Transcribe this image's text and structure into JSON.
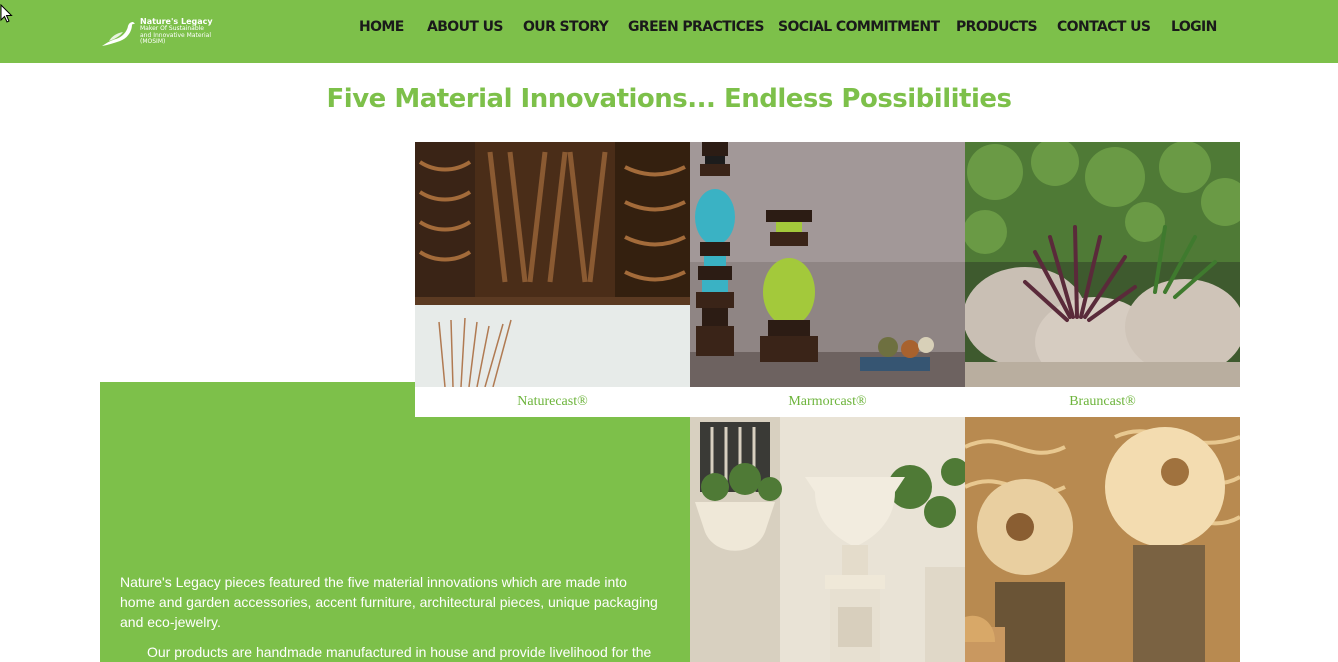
{
  "brand": {
    "name": "Nature's Legacy",
    "tagline_lines": [
      "Maker Of Sustainable",
      "and Innovative Material",
      "(MOSIM)"
    ],
    "logo_icon": "bird-icon",
    "color": "#7dc04a"
  },
  "nav": {
    "items": [
      {
        "label": "HOME"
      },
      {
        "label": "ABOUT US"
      },
      {
        "label": "OUR STORY"
      },
      {
        "label": "GREEN PRACTICES"
      },
      {
        "label": "SOCIAL COMMITMENT"
      },
      {
        "label": "PRODUCTS"
      },
      {
        "label": "CONTACT US"
      },
      {
        "label": "LOGIN"
      }
    ]
  },
  "main": {
    "headline": "Five Material Innovations... Endless Possibilities",
    "intro_paragraph": "Nature's Legacy pieces featured the five material innovations which are made into home and garden accessories, accent furniture, architectural pieces, unique packaging and eco-jewelry.",
    "second_paragraph": "Our products are handmade manufactured in house and provide livelihood for the",
    "materials": [
      {
        "label": "Naturecast®",
        "image": "carved-wall-panel-photo"
      },
      {
        "label": "Marmorcast®",
        "image": "candle-holders-photo"
      },
      {
        "label": "Brauncast®",
        "image": "garden-planter-photo"
      },
      {
        "label": "",
        "image": "classical-urn-photo"
      },
      {
        "label": "",
        "image": "sculpted-fountain-photo"
      }
    ]
  }
}
